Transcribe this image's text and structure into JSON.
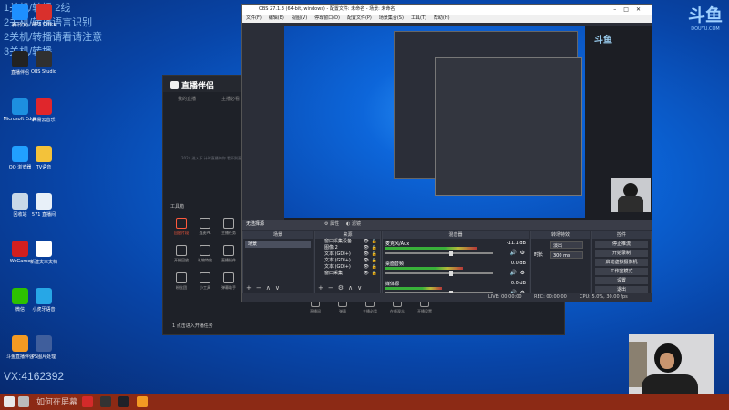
{
  "overlay": {
    "line1": "1关机/转播 2线",
    "line2": "2关机/转播语言识别",
    "line3": "2关机/转播请看请注意",
    "line4": "3关机/转播",
    "contact": "VX:4162392",
    "taskbar_text": "如何在屏幕"
  },
  "desktop_icons": [
    {
      "label": "腾讯QQ",
      "color": "#1e90ff"
    },
    {
      "label": "WPS Office",
      "color": "#d9302c"
    },
    {
      "label": "直播伴侣",
      "color": "#222222"
    },
    {
      "label": "OBS Studio",
      "color": "#303030"
    },
    {
      "label": "Microsoft Edge",
      "color": "#1d8fe0"
    },
    {
      "label": "网易云音乐",
      "color": "#e0262c"
    },
    {
      "label": "QQ 浏览器",
      "color": "#21a0ff"
    },
    {
      "label": "TV语音",
      "color": "#f3c23a"
    },
    {
      "label": "回收站",
      "color": "#c8d8e8"
    },
    {
      "label": "571 直播间",
      "color": "#e8f0f8"
    },
    {
      "label": "WeGame",
      "color": "#d21f1f"
    },
    {
      "label": "新建文本文档",
      "color": "#ffffff"
    },
    {
      "label": "微信",
      "color": "#2dc100"
    },
    {
      "label": "小虎牙语音",
      "color": "#27a7e6"
    },
    {
      "label": "斗鱼直播伴侣",
      "color": "#f39a23"
    },
    {
      "label": "PS图片处理",
      "color": "#3f5e9c"
    }
  ],
  "obs": {
    "title": "OBS 27.1.3 (64-bit, windows) - 配置文件: 未命名 - 场景: 未命名",
    "menu": [
      "文件(F)",
      "编辑(E)",
      "视图(V)",
      "停靠窗口(D)",
      "配置文件(P)",
      "场景集合(S)",
      "工具(T)",
      "帮助(H)"
    ],
    "scene_label": "无选择源",
    "toolbar_props": "属性",
    "toolbar_filters": "滤镜",
    "docks": {
      "scenes": "场景",
      "sources": "来源",
      "mixer": "混音器",
      "transitions": "转场特效",
      "controls": "控件"
    },
    "scenes": [
      "场景"
    ],
    "sources": [
      "窗口采集设备",
      "图像 2",
      "文本 (GDI+)",
      "文本 (GDI+)",
      "文本 (GDI+)",
      "窗口采集"
    ],
    "mixer": [
      {
        "name": "麦克风/Aux",
        "db": "-11.1 dB",
        "level": 0.65
      },
      {
        "name": "桌面音频",
        "db": "0.0 dB",
        "level": 0.55
      },
      {
        "name": "媒体源",
        "db": "0.0 dB",
        "level": 0.4
      }
    ],
    "transition_type": "淡出",
    "duration_label": "时长",
    "duration_value": "300 ms",
    "controls": [
      "停止推流",
      "开始录制",
      "启动虚拟摄像机",
      "工作室模式",
      "设置",
      "退出"
    ],
    "status": {
      "live": "LIVE: 00:00:00",
      "rec": "REC: 00:00:00",
      "cpu": "CPU: 5.0%, 30.00 fps"
    }
  },
  "assist": {
    "app_name": "直播伴侣",
    "tabs": [
      "我的直播",
      "主播必看"
    ],
    "center_text": "2024 进入下 计时直播的你 看不到直播",
    "tools_label": "工具箱",
    "tools": [
      {
        "label": "回放片段",
        "active": true
      },
      {
        "label": "连麦PK",
        "active": false
      },
      {
        "label": "主播任务",
        "active": false
      },
      {
        "label": "开播回放",
        "active": false
      },
      {
        "label": "礼物特效",
        "active": false
      },
      {
        "label": "直播插件",
        "active": false
      },
      {
        "label": "粉丝团",
        "active": false
      },
      {
        "label": "小工具",
        "active": false
      },
      {
        "label": "弹幕助手",
        "active": false
      }
    ],
    "bottom_tools": [
      "直播间",
      "弹幕",
      "主播必看",
      "在线观众",
      "开播设置"
    ],
    "footer": "1 点击进入开播任务"
  },
  "inner_preview": {
    "douyu": "斗鱼"
  },
  "douyu": {
    "logo": "斗鱼",
    "url": "DOUYU.COM"
  }
}
